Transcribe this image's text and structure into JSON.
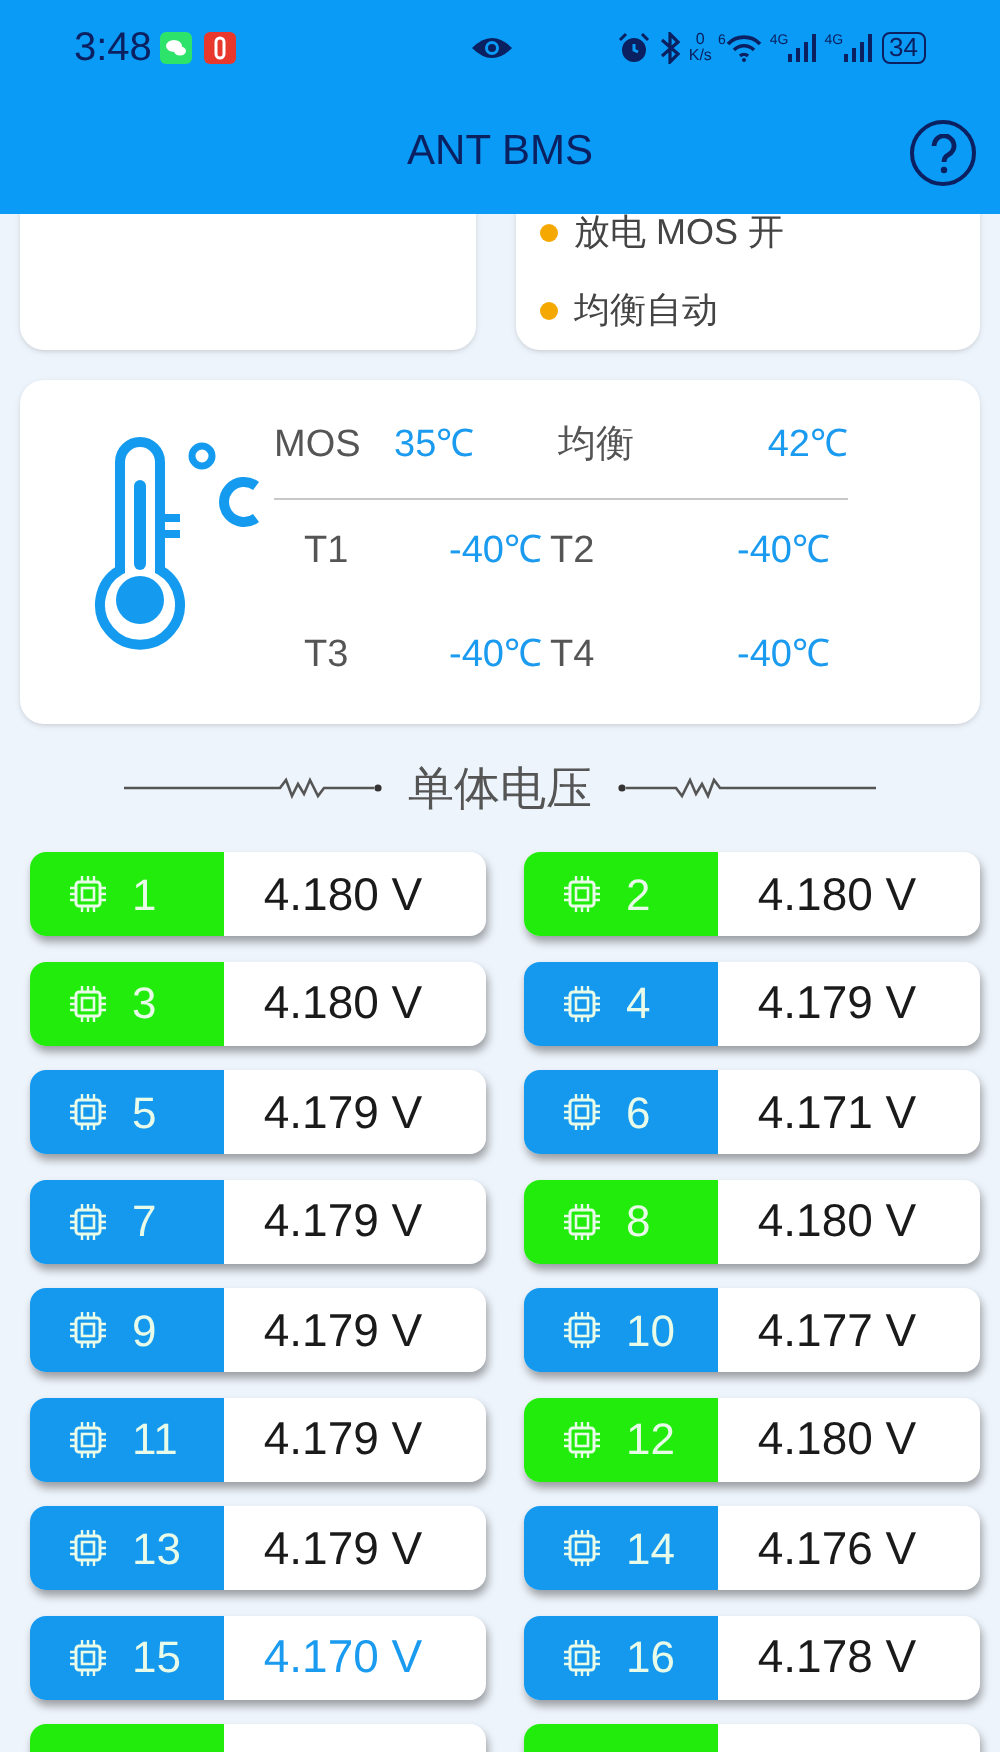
{
  "status_bar": {
    "time": "3:48",
    "net_speed_value": "0",
    "net_speed_unit": "K/s",
    "wifi_badge": "6",
    "sim1_badge": "4G",
    "sim2_badge": "4G",
    "battery": "34"
  },
  "app_bar": {
    "title": "ANT BMS"
  },
  "status_card": {
    "items": [
      {
        "label": "放电 MOS 开",
        "color": "#f5a800"
      },
      {
        "label": "均衡自动",
        "color": "#f5a800"
      }
    ]
  },
  "temperature_card": {
    "rows": [
      [
        {
          "label": "MOS",
          "value": "35℃"
        },
        {
          "label": "均衡",
          "value": "42℃"
        }
      ],
      [
        {
          "label": "T1",
          "value": "-40℃"
        },
        {
          "label": "T2",
          "value": "-40℃"
        }
      ],
      [
        {
          "label": "T3",
          "value": "-40℃"
        },
        {
          "label": "T4",
          "value": "-40℃"
        }
      ]
    ]
  },
  "section_title": "单体电压",
  "cells": [
    {
      "index": "1",
      "voltage": "4.180 V",
      "kind": "max"
    },
    {
      "index": "2",
      "voltage": "4.180 V",
      "kind": "max"
    },
    {
      "index": "3",
      "voltage": "4.180 V",
      "kind": "max"
    },
    {
      "index": "4",
      "voltage": "4.179 V",
      "kind": "normal"
    },
    {
      "index": "5",
      "voltage": "4.179 V",
      "kind": "normal"
    },
    {
      "index": "6",
      "voltage": "4.171 V",
      "kind": "normal"
    },
    {
      "index": "7",
      "voltage": "4.179 V",
      "kind": "normal"
    },
    {
      "index": "8",
      "voltage": "4.180 V",
      "kind": "max"
    },
    {
      "index": "9",
      "voltage": "4.179 V",
      "kind": "normal"
    },
    {
      "index": "10",
      "voltage": "4.177 V",
      "kind": "normal"
    },
    {
      "index": "11",
      "voltage": "4.179 V",
      "kind": "normal"
    },
    {
      "index": "12",
      "voltage": "4.180 V",
      "kind": "max"
    },
    {
      "index": "13",
      "voltage": "4.179 V",
      "kind": "normal"
    },
    {
      "index": "14",
      "voltage": "4.176 V",
      "kind": "normal"
    },
    {
      "index": "15",
      "voltage": "4.170 V",
      "kind": "min"
    },
    {
      "index": "16",
      "voltage": "4.178 V",
      "kind": "normal"
    },
    {
      "kind": "max"
    },
    {
      "kind": "max"
    }
  ]
}
